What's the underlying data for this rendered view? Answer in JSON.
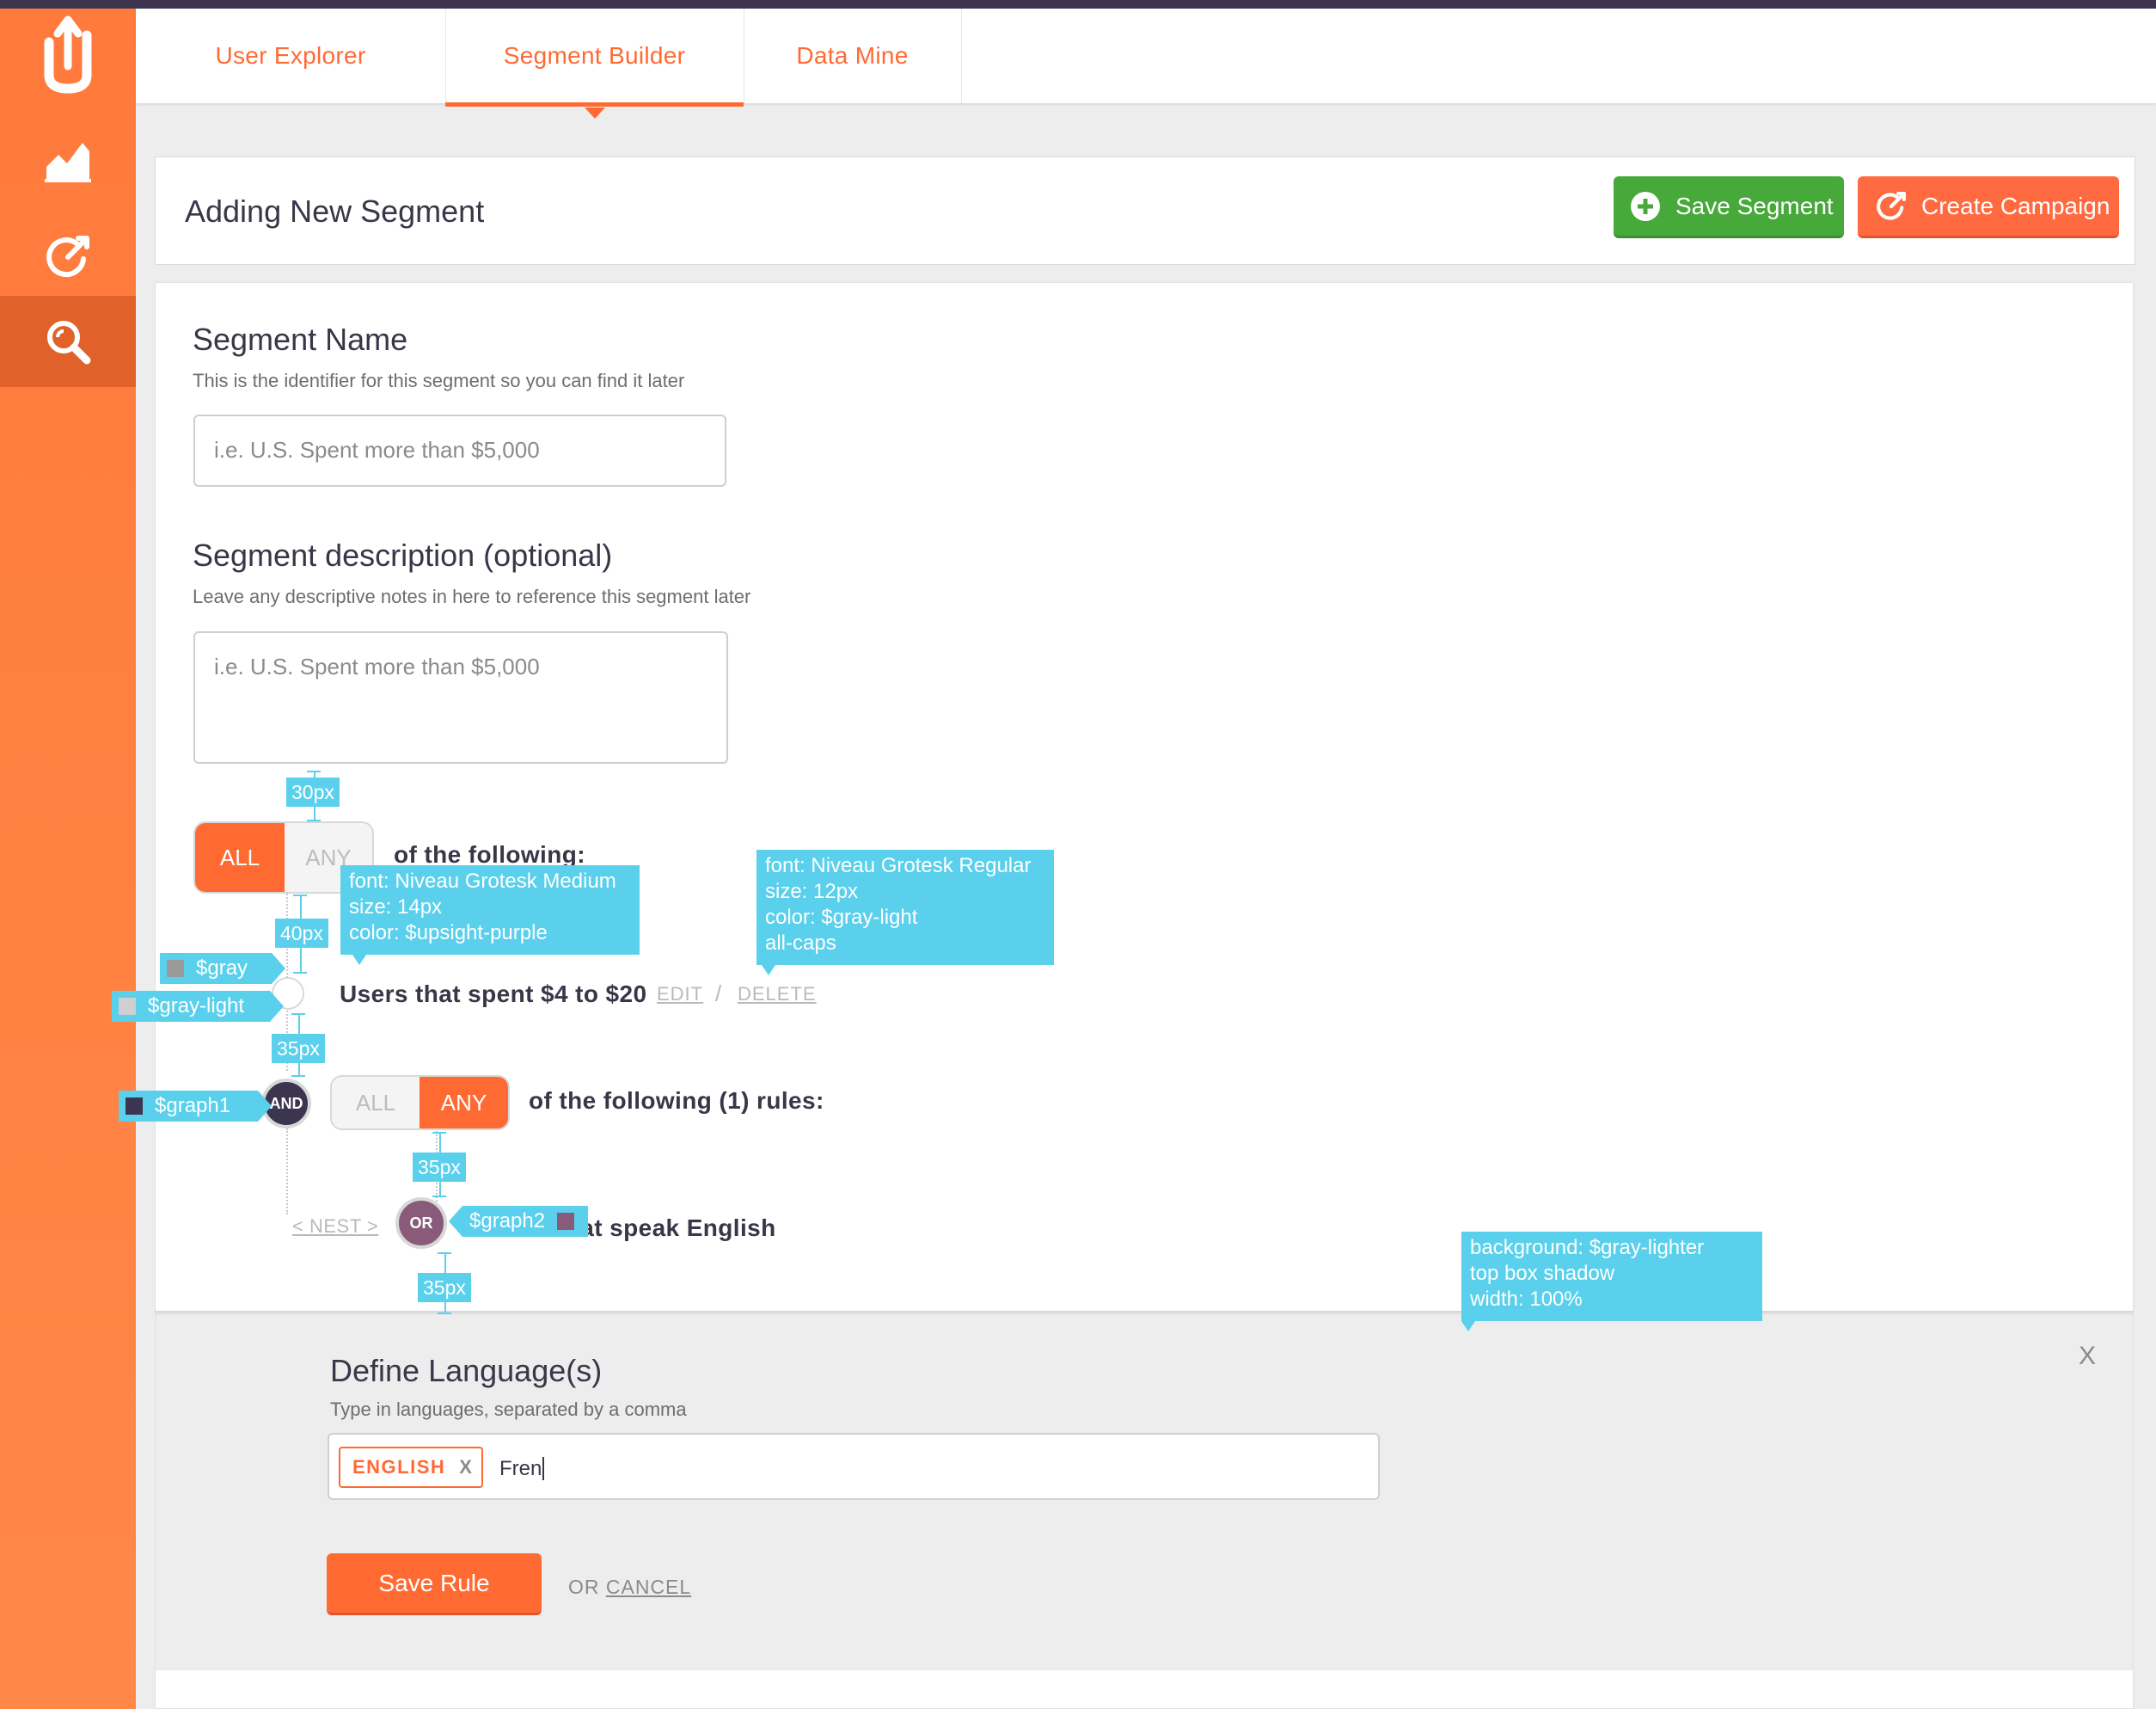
{
  "tabs": [
    {
      "label": "User Explorer"
    },
    {
      "label": "Segment Builder"
    },
    {
      "label": "Data Mine"
    }
  ],
  "sidebar": {
    "items": [
      {
        "icon": "upsight-logo-icon"
      },
      {
        "icon": "chart-icon"
      },
      {
        "icon": "target-icon"
      },
      {
        "icon": "search-icon",
        "active": true
      }
    ]
  },
  "header": {
    "title": "Adding New Segment",
    "save_segment": "Save Segment",
    "create_campaign": "Create Campaign"
  },
  "form": {
    "name_title": "Segment Name",
    "name_help": "This is the identifier for this segment so you can find it later",
    "name_placeholder": "i.e. U.S. Spent more than $5,000",
    "desc_title": "Segment description (optional)",
    "desc_help": "Leave any descriptive notes in here to reference this segment later",
    "desc_placeholder": "i.e. U.S. Spent more than $5,000"
  },
  "rules": {
    "toggle1": {
      "all": "ALL",
      "any": "ANY",
      "selected": "ALL"
    },
    "of_following": "of the following:",
    "rule1_text": "Users that spent $4 to $20",
    "edit": "EDIT",
    "slash": "/",
    "delete": "DELETE",
    "and_label": "AND",
    "toggle2": {
      "all": "ALL",
      "any": "ANY",
      "selected": "ANY"
    },
    "of_following_rules": "of the following (1) rules:",
    "nest": "< NEST >",
    "or_label": "OR",
    "rule2_text": "Users that speak English"
  },
  "panel": {
    "title": "Define Language(s)",
    "help": "Type in languages, separated by a comma",
    "chip": "ENGLISH",
    "chip_remove": "X",
    "input_value": "Fren",
    "save_rule": "Save Rule",
    "or_text": "OR",
    "cancel": "CANCEL",
    "close": "X"
  },
  "annotations": {
    "gap_30": "30px",
    "gap_40": "40px",
    "gap_35a": "35px",
    "gap_35b": "35px",
    "gap_35c": "35px",
    "font_medium": [
      "font: Niveau Grotesk Medium",
      "size: 14px",
      "color: $upsight-purple"
    ],
    "font_regular": [
      "font: Niveau Grotesk Regular",
      "size: 12px",
      "color: $gray-light",
      "all-caps"
    ],
    "bg_note": [
      "background: $gray-lighter",
      "top box shadow",
      "width: 100%"
    ],
    "swatch_gray": "$gray",
    "swatch_gray_light": "$gray-light",
    "swatch_graph1": "$graph1",
    "swatch_graph2": "$graph2"
  },
  "colors": {
    "brand_orange": "#ff6a33",
    "sidebar_orange": "#ff7a3c",
    "save_green": "#47a93a",
    "purple_dark": "#3d3550",
    "graph1": "#3b3550",
    "graph2": "#8a5a7a",
    "annotation_cyan": "#5ad0ec"
  }
}
